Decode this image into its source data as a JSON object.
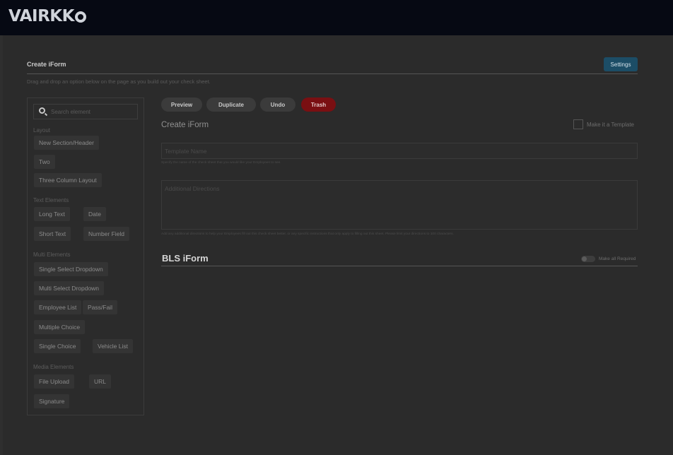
{
  "header": {
    "brand": "VAIRKK"
  },
  "page": {
    "title": "Create iForm",
    "subtitle": "Drag and drop an option below on the page as you build out your check sheet.",
    "settings_label": "Settings"
  },
  "sidebar": {
    "search_placeholder": "Search element",
    "groups": [
      {
        "label": "Layout",
        "items": [
          "New Section/Header",
          "Two",
          "Three Column Layout"
        ]
      },
      {
        "label": "Text Elements",
        "items": [
          "Long Text",
          "Date",
          "Short Text",
          "Number Field"
        ]
      },
      {
        "label": "Multi Elements",
        "items": [
          "Single Select Dropdown",
          "Multi Select Dropdown",
          "Employee List",
          "Pass/Fail",
          "Multiple Choice",
          "Single Choice",
          "Vehicle List"
        ]
      },
      {
        "label": "Media Elements",
        "items": [
          "File Upload",
          "URL",
          "Signature"
        ]
      }
    ]
  },
  "toolbar": {
    "preview": "Preview",
    "duplicate": "Duplicate",
    "undo": "Undo",
    "trash": "Trash"
  },
  "form": {
    "heading": "Create iForm",
    "template_toggle_label": "Make it a Template",
    "name_placeholder": "Template Name",
    "name_helper": "Specify the name of the check sheet that you would like your Employees to see.",
    "directions_placeholder": "Additional Directions",
    "directions_helper": "Add any additional directions to help your Employees fill out this check sheet better, or any specific instructions that only apply to filling out this sheet. Please limit your directions to 100 characters.",
    "section_title": "BLS iForm",
    "required_label": "Make all Required"
  },
  "colors": {
    "primary_button": "#1c4d66",
    "trash_button": "#7a0f12",
    "topbar": "#060913"
  }
}
